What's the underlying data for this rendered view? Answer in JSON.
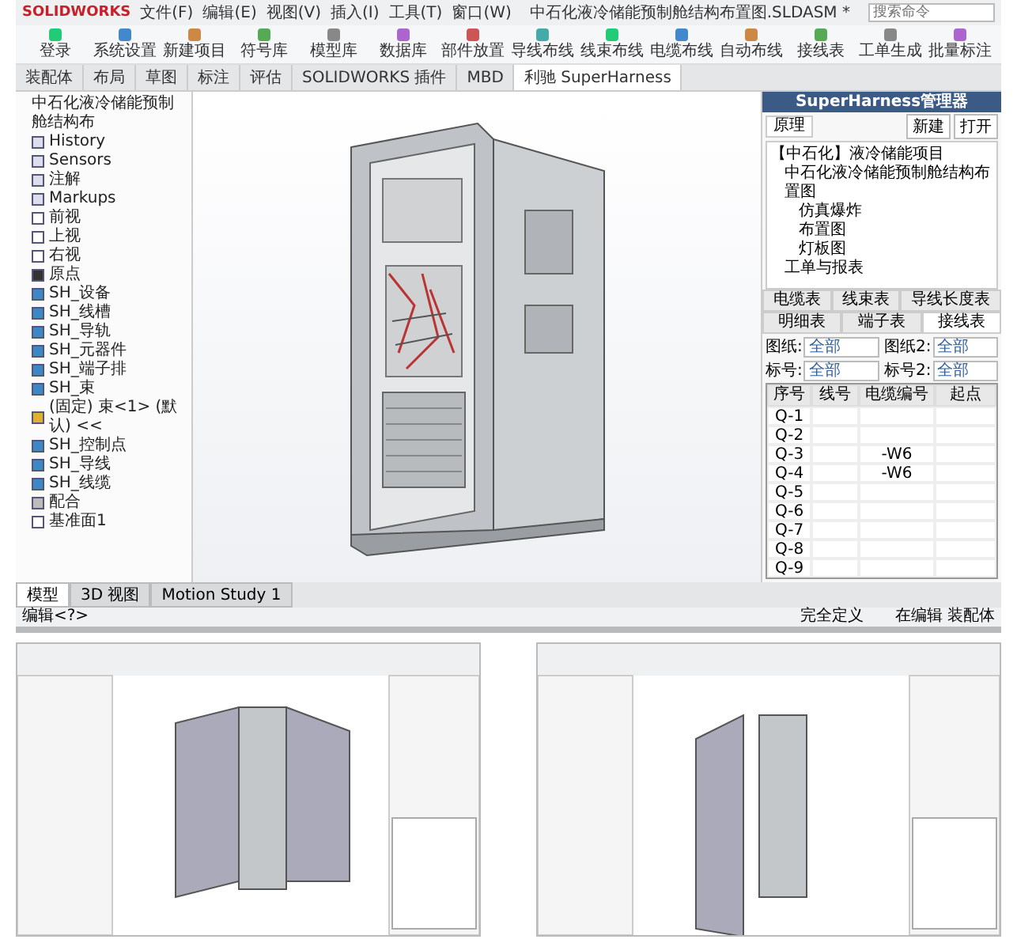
{
  "titlebar": {
    "app": "SOLIDWORKS",
    "menus": [
      "文件(F)",
      "编辑(E)",
      "视图(V)",
      "插入(I)",
      "工具(T)",
      "窗口(W)"
    ],
    "title": "中石化液冷储能预制舱结构布置图.SLDASM *",
    "search": {
      "placeholder": "搜索命令"
    }
  },
  "ribbon": [
    "登录",
    "系统设置",
    "新建项目",
    "符号库",
    "模型库",
    "数据库",
    "部件放置",
    "导线布线",
    "线束布线",
    "电缆布线",
    "自动布线",
    "接线表",
    "工单生成",
    "批量标注"
  ],
  "tabs": [
    {
      "label": "装配体",
      "selected": false
    },
    {
      "label": "布局",
      "selected": false
    },
    {
      "label": "草图",
      "selected": false
    },
    {
      "label": "标注",
      "selected": false
    },
    {
      "label": "评估",
      "selected": false
    },
    {
      "label": "SOLIDWORKS 插件",
      "selected": false
    },
    {
      "label": "MBD",
      "selected": false
    },
    {
      "label": "利驰 SuperHarness",
      "selected": true
    }
  ],
  "feature_tree": {
    "root": "中石化液冷储能预制舱结构布",
    "items": [
      {
        "label": "History",
        "kind": "folder"
      },
      {
        "label": "Sensors",
        "kind": "folder"
      },
      {
        "label": "注解",
        "kind": "folder"
      },
      {
        "label": "Markups",
        "kind": "folder"
      },
      {
        "label": "前视",
        "kind": "plane"
      },
      {
        "label": "上视",
        "kind": "plane"
      },
      {
        "label": "右视",
        "kind": "plane"
      },
      {
        "label": "原点",
        "kind": "origin"
      },
      {
        "label": "SH_设备",
        "kind": "shfolder"
      },
      {
        "label": "SH_线槽",
        "kind": "shfolder"
      },
      {
        "label": "SH_导轨",
        "kind": "shfolder"
      },
      {
        "label": "SH_元器件",
        "kind": "shfolder"
      },
      {
        "label": "SH_端子排",
        "kind": "shfolder"
      },
      {
        "label": "SH_束",
        "kind": "shfolder"
      },
      {
        "label": "(固定) 束<1> (默认) <<",
        "kind": "part"
      },
      {
        "label": "SH_控制点",
        "kind": "shfolder"
      },
      {
        "label": "SH_导线",
        "kind": "shfolder"
      },
      {
        "label": "SH_线缆",
        "kind": "shfolder"
      },
      {
        "label": "配合",
        "kind": "mates"
      },
      {
        "label": "基准面1",
        "kind": "plane"
      }
    ]
  },
  "bottom_tabs": [
    {
      "label": "模型",
      "selected": true
    },
    {
      "label": "3D 视图",
      "selected": false
    },
    {
      "label": "Motion Study 1",
      "selected": false
    }
  ],
  "status": {
    "left": "编辑<?>",
    "middle": "完全定义",
    "right": "在编辑 装配体"
  },
  "manager": {
    "title": "SuperHarness管理器",
    "tab": "原理",
    "buttons": [
      "新建",
      "打开"
    ],
    "tree": [
      {
        "label": "【中石化】液冷储能项目",
        "children": [
          {
            "label": "中石化液冷储能预制舱结构布置图",
            "children": [
              {
                "label": "仿真爆炸"
              },
              {
                "label": "布置图"
              },
              {
                "label": "灯板图"
              }
            ]
          },
          {
            "label": "工单与报表"
          }
        ]
      }
    ],
    "report_tabs": [
      [
        {
          "label": "电缆表",
          "selected": false
        },
        {
          "label": "线束表",
          "selected": false
        },
        {
          "label": "导线长度表",
          "selected": false
        }
      ],
      [
        {
          "label": "明细表",
          "selected": false
        },
        {
          "label": "端子表",
          "selected": false
        },
        {
          "label": "接线表",
          "selected": true
        }
      ]
    ],
    "filters": [
      {
        "label": "图纸:",
        "value": "全部"
      },
      {
        "label": "图纸2:",
        "value": "全部"
      },
      {
        "label": "标号:",
        "value": "全部"
      },
      {
        "label": "标号2:",
        "value": "全部"
      }
    ],
    "columns": [
      "序号",
      "线号",
      "电缆编号",
      "起点"
    ],
    "rows": [
      [
        "Q-1",
        "",
        ""
      ],
      [
        "Q-2",
        "",
        ""
      ],
      [
        "Q-3",
        "",
        "-W6"
      ],
      [
        "Q-4",
        "",
        "-W6"
      ],
      [
        "Q-5",
        "",
        ""
      ],
      [
        "Q-6",
        "",
        ""
      ],
      [
        "Q-7",
        "",
        ""
      ],
      [
        "Q-8",
        "",
        ""
      ],
      [
        "Q-9",
        "",
        ""
      ]
    ]
  },
  "thumbnails": [
    {
      "kind": "double-door"
    },
    {
      "kind": "single-door"
    }
  ]
}
